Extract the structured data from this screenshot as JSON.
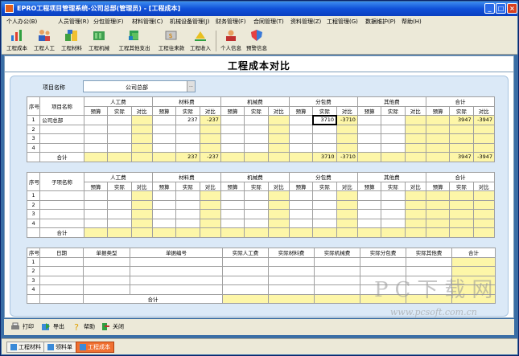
{
  "window": {
    "title": "EPRO工程项目管理系统-公司总部(管理员) - [工程成本]"
  },
  "menu": [
    "个人办公(B)",
    "人员管理(R)",
    "分包管理(F)",
    "材料管理(C)",
    "机械设备管理(J)",
    "财务管理(F)",
    "合同管理(T)",
    "资料管理(Z)",
    "工程管理(G)",
    "数据维护(P)",
    "帮助(H)"
  ],
  "toolbar": [
    {
      "label": "工程成本",
      "icon": "bar-chart-icon"
    },
    {
      "label": "工程人工",
      "icon": "workers-icon"
    },
    {
      "label": "工程材料",
      "icon": "materials-icon"
    },
    {
      "label": "工程机械",
      "icon": "machinery-icon"
    },
    {
      "label": "工程其他支出",
      "icon": "expense-icon"
    },
    {
      "label": "工程往来款",
      "icon": "money-icon"
    },
    {
      "label": "工程收入",
      "icon": "income-icon"
    },
    {
      "label": "个人信息",
      "icon": "user-icon"
    },
    {
      "label": "预警信息",
      "icon": "warning-shield-icon"
    }
  ],
  "doc": {
    "title": "工程成本对比",
    "project_label": "项目名称",
    "project_value": "公司总部"
  },
  "table1": {
    "col_seq": "序号",
    "col_name": "项目名称",
    "groups": [
      "人工费",
      "材料费",
      "机械费",
      "分包费",
      "其他费",
      "合计"
    ],
    "sub": [
      "预算",
      "实际",
      "对比"
    ],
    "rows": [
      {
        "seq": "1",
        "name": "公司总部",
        "mat_actual": "237",
        "mat_diff": "-237",
        "sub_actual": "3710",
        "sub_diff": "-3710",
        "total_actual": "3947",
        "total_diff": "-3947"
      },
      {
        "seq": "2"
      },
      {
        "seq": "3"
      },
      {
        "seq": "4"
      }
    ],
    "total_label": "合计",
    "total": {
      "mat_actual": "237",
      "mat_diff": "-237",
      "sub_actual": "3710",
      "sub_diff": "-3710",
      "total_actual": "3947",
      "total_diff": "-3947"
    }
  },
  "table2": {
    "col_seq": "序号",
    "col_name": "子项名称",
    "groups": [
      "人工费",
      "材料费",
      "机械费",
      "分包费",
      "其他费",
      "合计"
    ],
    "sub": [
      "预算",
      "实际",
      "对比"
    ],
    "rows": [
      "1",
      "2",
      "3",
      "4"
    ],
    "total_label": "合计"
  },
  "table3": {
    "headers": [
      "序号",
      "日期",
      "单据类型",
      "单据编号",
      "实际人工费",
      "实际材料费",
      "实际机械费",
      "实际分包费",
      "实际其他费",
      "合计"
    ],
    "rows": [
      "1",
      "2",
      "3",
      "4"
    ],
    "total_label": "合计"
  },
  "bottombar": {
    "print": "打印",
    "export": "导出",
    "help": "帮助",
    "close": "关闭"
  },
  "taskbar": [
    {
      "label": "工程材料",
      "active": false
    },
    {
      "label": "领料单",
      "active": false
    },
    {
      "label": "工程成本",
      "active": true
    }
  ],
  "watermark": {
    "big": "PC下载网",
    "small": "www.pcsoft.com.cn"
  }
}
